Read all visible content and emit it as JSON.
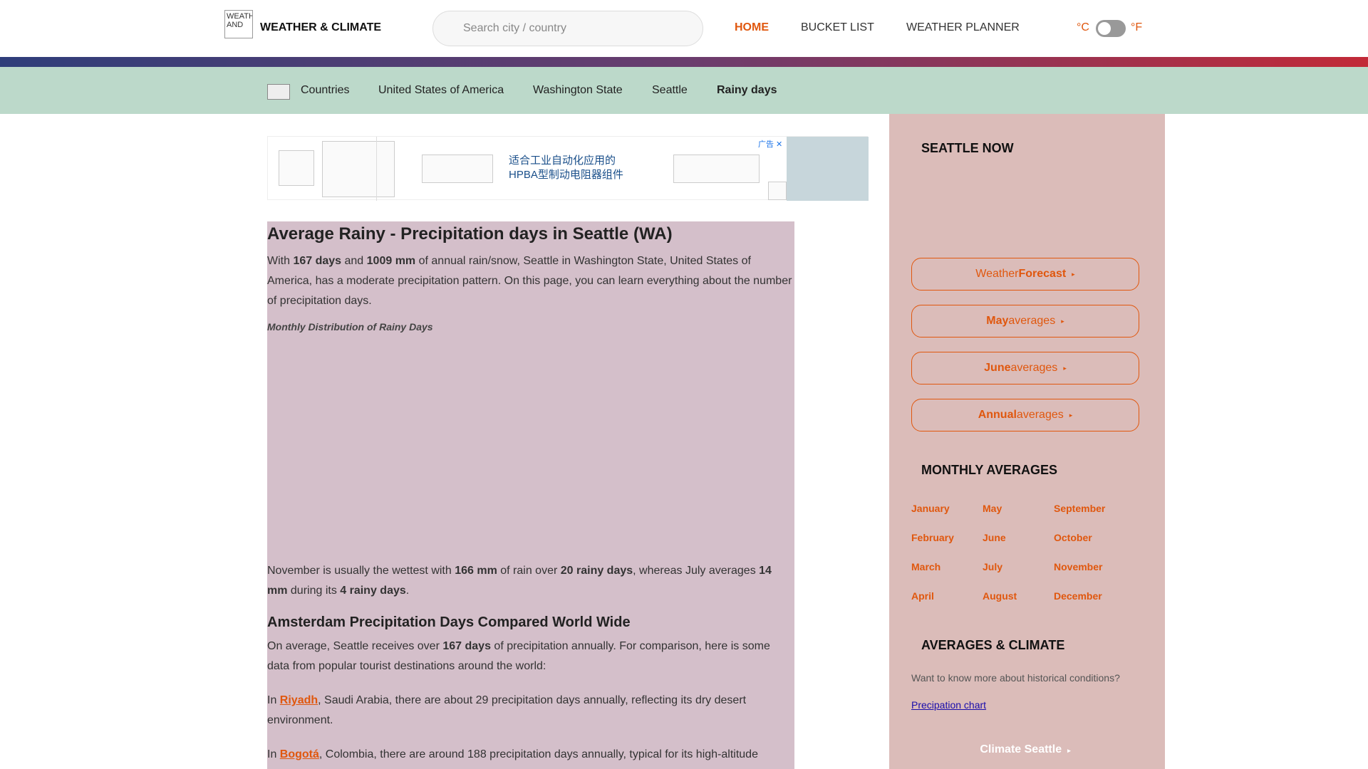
{
  "header": {
    "logo_alt": "WEATHER AND",
    "brand": "WEATHER & CLIMATE",
    "search_placeholder": "Search city / country",
    "nav": [
      {
        "label": "HOME"
      },
      {
        "label": "BUCKET LIST"
      },
      {
        "label": "WEATHER PLANNER"
      }
    ],
    "unit_c": "°C",
    "unit_f": "°F",
    "accent": "#e0570e"
  },
  "breadcrumb": {
    "items": [
      "Countries",
      "United States of America",
      "Washington State",
      "Seattle",
      "Rainy days"
    ]
  },
  "ad": {
    "text_line1": "适合工业自动化应用的",
    "text_line2": "HPBA型制动电阻器组件",
    "badge": "广告 ✕"
  },
  "article": {
    "title": "Average Rainy - Precipitation days in Seattle (WA)",
    "intro_p1": "With ",
    "intro_days": "167 days",
    "intro_p2": " and ",
    "intro_mm": "1009 mm",
    "intro_p3": " of annual rain/snow, Seattle in Washington State, United States of America, has a moderate precipitation pattern. On this page, you can learn everything about the number of precipitation days.",
    "chart_caption": "Monthly Distribution of Rainy Days",
    "wettest_p1": "November is usually the wettest with ",
    "wettest_mm": "166 mm",
    "wettest_p2": " of rain over ",
    "wettest_days": "20 rainy days",
    "wettest_p3": ", whereas July averages ",
    "july_mm": "14 mm",
    "wettest_p4": " during its ",
    "july_days": "4 rainy days",
    "wettest_p5": ".",
    "compare_title": "Amsterdam Precipitation Days Compared World Wide",
    "compare_p1": "On average, Seattle receives over ",
    "compare_days": "167 days",
    "compare_p2": " of precipitation annually. For comparison, here is some data from popular tourist destinations around the world:",
    "riyadh_pre": "In ",
    "riyadh_link": "Riyadh",
    "riyadh_post": ", Saudi Arabia, there are about 29 precipitation days annually, reflecting its dry desert environment.",
    "bogota_pre": "In ",
    "bogota_link": "Bogotá",
    "bogota_post": ", Colombia, there are around 188 precipitation days annually, typical for its high-altitude"
  },
  "sidebar": {
    "now_title": "SEATTLE NOW",
    "btn_forecast_a": "Weather ",
    "btn_forecast_b": "Forecast",
    "btn_may_a": "May",
    "btn_may_b": " averages",
    "btn_june_a": "June",
    "btn_june_b": " averages",
    "btn_annual_a": "Annual",
    "btn_annual_b": " averages",
    "arrow": "▸",
    "monthly_title": "MONTHLY AVERAGES",
    "months": [
      "January",
      "May",
      "September",
      "February",
      "June",
      "October",
      "March",
      "July",
      "November",
      "April",
      "August",
      "December"
    ],
    "climate_title": "AVERAGES & CLIMATE",
    "climate_note": "Want to know more about historical conditions?",
    "chart_link": "Precipation chart",
    "climate_link": "Climate Seattle"
  }
}
